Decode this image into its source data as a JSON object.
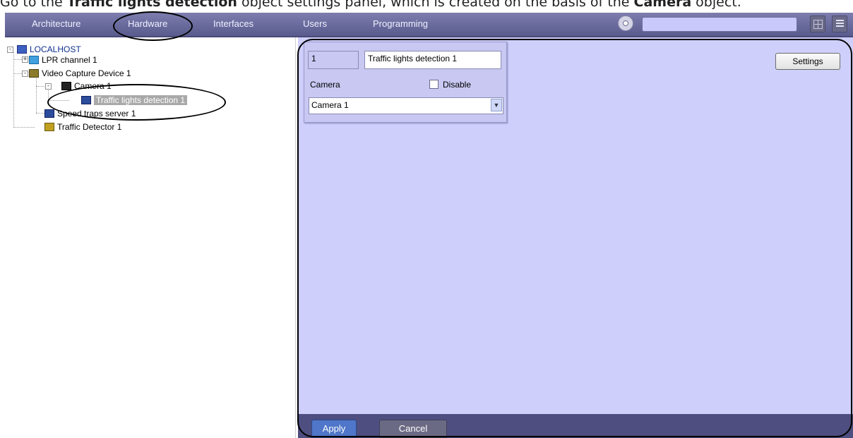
{
  "caption": {
    "prefix": "Go to the ",
    "bold1": "Traffic lights detection",
    "middle": " object settings panel, which is created on the basis of the ",
    "bold2": "Camera",
    "suffix": " object."
  },
  "tabs": [
    "Architecture",
    "Hardware",
    "Interfaces",
    "Users",
    "Programming"
  ],
  "tree": {
    "localhost": "LOCALHOST",
    "lpr": "LPR channel 1",
    "video": "Video Capture Device 1",
    "camera": "Camera 1",
    "traffic_lights": "Traffic lights detection 1",
    "speed": "Speed traps server 1",
    "traffic_detector": "Traffic Detector 1"
  },
  "form": {
    "id_value": "1",
    "name_value": "Traffic lights detection 1",
    "camera_label": "Camera",
    "disable_label": "Disable",
    "disable_checked": false,
    "camera_selected": "Camera 1"
  },
  "buttons": {
    "settings": "Settings",
    "apply": "Apply",
    "cancel": "Cancel"
  },
  "colors": {
    "panel_bg": "#cfcffb",
    "topbar": "#6a6b9e",
    "apply_btn": "#4f76c8"
  }
}
